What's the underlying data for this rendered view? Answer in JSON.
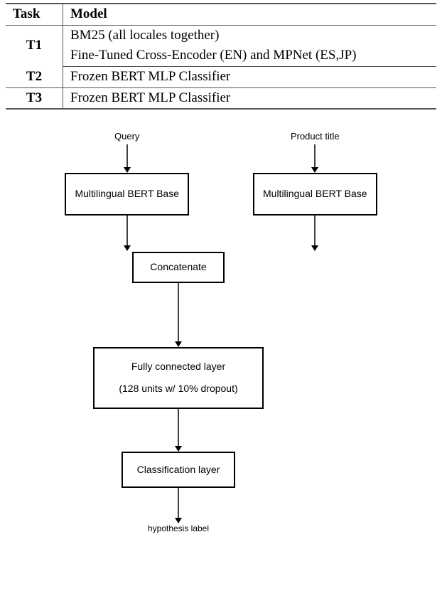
{
  "table": {
    "headers": {
      "task": "Task",
      "model": "Model"
    },
    "t1": {
      "label": "T1",
      "line1": "BM25 (all locales together)",
      "line2": "Fine-Tuned Cross-Encoder (EN) and MPNet (ES,JP)"
    },
    "t2": {
      "label": "T2",
      "model": "Frozen BERT MLP Classifier"
    },
    "t3": {
      "label": "T3",
      "model": "Frozen BERT MLP Classifier"
    }
  },
  "diagram": {
    "inputs": {
      "query": "Query",
      "product": "Product title"
    },
    "bert_label": "Multilingual BERT Base",
    "concat": "Concatenate",
    "fc_line1": "Fully connected layer",
    "fc_line2": "(128 units w/ 10% dropout)",
    "cls": "Classification layer",
    "output": "hypothesis label"
  }
}
